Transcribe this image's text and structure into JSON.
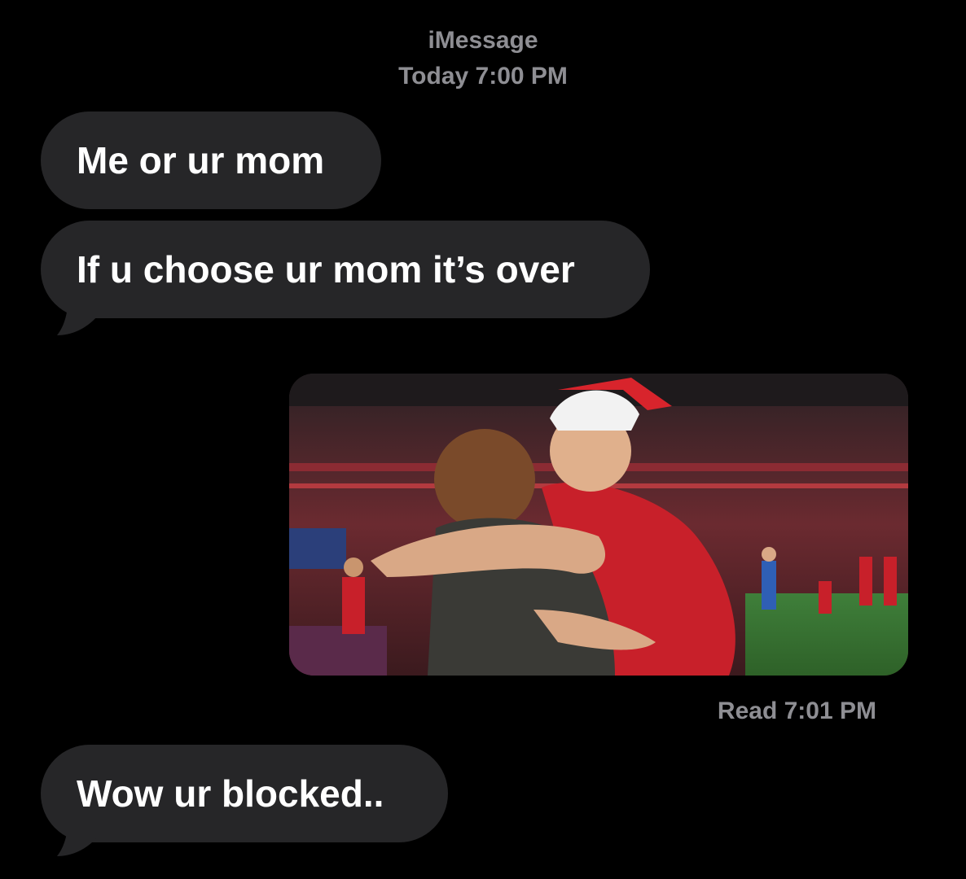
{
  "header": {
    "service": "iMessage",
    "timestamp": "Today 7:00 PM"
  },
  "messages": [
    {
      "direction": "incoming",
      "type": "text",
      "text": "Me or ur mom"
    },
    {
      "direction": "incoming",
      "type": "text",
      "text": "If u choose ur mom it’s over"
    },
    {
      "direction": "outgoing",
      "type": "image",
      "description_icon": "photo-attachment"
    },
    {
      "direction": "incoming",
      "type": "text",
      "text": "Wow ur blocked.."
    }
  ],
  "receipt": "Read 7:01 PM",
  "colors": {
    "background": "#000000",
    "incoming_bubble": "#262628",
    "meta_text": "#8e8e93",
    "text": "#ffffff"
  }
}
